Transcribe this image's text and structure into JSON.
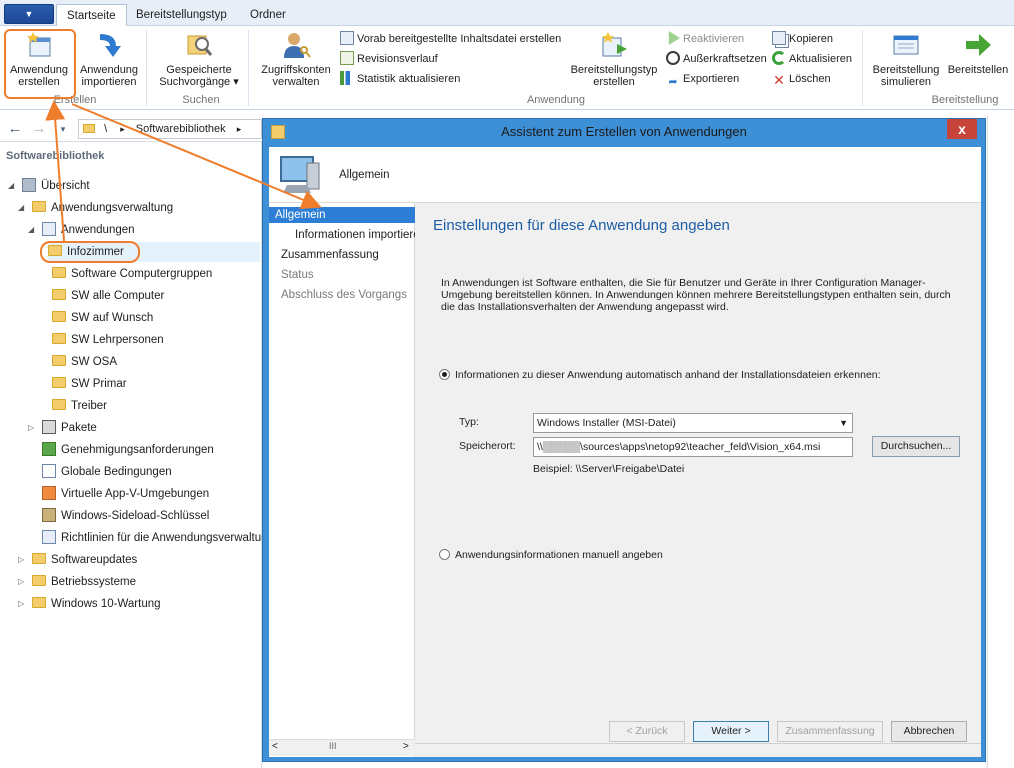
{
  "app_button": "▼",
  "tabs": [
    {
      "label": "Startseite",
      "active": true
    },
    {
      "label": "Bereitstellungstyp",
      "active": false
    },
    {
      "label": "Ordner",
      "active": false
    }
  ],
  "ribbon": {
    "groups": {
      "erstellen": "Erstellen",
      "suchen": "Suchen",
      "anwendung": "Anwendung",
      "bereitstellung": "Bereitstellung"
    },
    "anwendung_erstellen": "Anwendung\nerstellen",
    "anwendung_erstellen_l1": "Anwendung",
    "anwendung_erstellen_l2": "erstellen",
    "anwendung_importieren_l1": "Anwendung",
    "anwendung_importieren_l2": "importieren",
    "gespeicherte_l1": "Gespeicherte",
    "gespeicherte_l2": "Suchvorgänge ▾",
    "zugriffskonten_l1": "Zugriffskonten",
    "zugriffskonten_l2": "verwalten",
    "vorab": "Vorab bereitgestellte Inhaltsdatei erstellen",
    "revisionsverlauf": "Revisionsverlauf",
    "statistik": "Statistik aktualisieren",
    "bereitstellungstyp_l1": "Bereitstellungstyp",
    "bereitstellungstyp_l2": "erstellen",
    "reaktivieren": "Reaktivieren",
    "ausserkraft": "Außerkraftsetzen",
    "exportieren": "Exportieren",
    "kopieren": "Kopieren",
    "aktualisieren": "Aktualisieren",
    "loeschen": "Löschen",
    "bereitstellung_sim_l1": "Bereitstellung",
    "bereitstellung_sim_l2": "simulieren",
    "bereitstellen": "Bereitstellen"
  },
  "breadcrumb": {
    "root": "\\",
    "current": "Softwarebibliothek",
    "separator": "▸"
  },
  "sidebar": {
    "title": "Softwarebibliothek",
    "items": [
      {
        "label": "Übersicht"
      },
      {
        "label": "Anwendungsverwaltung"
      },
      {
        "label": "Anwendungen"
      },
      {
        "label": "Infozimmer"
      },
      {
        "label": "Software Computergruppen"
      },
      {
        "label": "SW alle Computer"
      },
      {
        "label": "SW auf Wunsch"
      },
      {
        "label": "SW Lehrpersonen"
      },
      {
        "label": "SW OSA"
      },
      {
        "label": "SW Primar"
      },
      {
        "label": "Treiber"
      },
      {
        "label": "Pakete"
      },
      {
        "label": "Genehmigungsanforderungen"
      },
      {
        "label": "Globale Bedingungen"
      },
      {
        "label": "Virtuelle App-V-Umgebungen"
      },
      {
        "label": "Windows-Sideload-Schlüssel"
      },
      {
        "label": "Richtlinien für die Anwendungsverwaltung"
      },
      {
        "label": "Softwareupdates"
      },
      {
        "label": "Betriebssysteme"
      },
      {
        "label": "Windows 10-Wartung"
      }
    ]
  },
  "wizard": {
    "title": "Assistent zum Erstellen von Anwendungen",
    "close": "x",
    "header_title": "Allgemein",
    "nav": [
      {
        "label": "Allgemein"
      },
      {
        "label": "Informationen importieren"
      },
      {
        "label": "Zusammenfassung"
      },
      {
        "label": "Status"
      },
      {
        "label": "Abschluss des Vorgangs"
      }
    ],
    "scroll_left": "<",
    "scroll_thumb": "III",
    "scroll_right": ">",
    "heading": "Einstellungen für diese Anwendung angeben",
    "description": "In Anwendungen ist Software enthalten, die Sie für Benutzer und Geräte in Ihrer Configuration Manager-Umgebung bereitstellen können. In Anwendungen können mehrere Bereitstellungstypen enthalten sein, durch die das Installationsverhalten der Anwendung angepasst wird.",
    "radio_auto": "Informationen zu dieser Anwendung automatisch anhand der Installationsdateien erkennen:",
    "type_label": "Typ:",
    "type_value": "Windows Installer (MSI-Datei)",
    "location_label": "Speicherort:",
    "location_value": "\\\\▒▒▒▒▒\\sources\\apps\\netop92\\teacher_feld\\Vision_x64.msi",
    "browse": "Durchsuchen...",
    "example": "Beispiel: \\\\Server\\Freigabe\\Datei",
    "radio_manual": "Anwendungsinformationen manuell angeben",
    "buttons": {
      "back": "< Zurück",
      "next": "Weiter >",
      "summary": "Zusammenfassung",
      "cancel": "Abbrechen"
    }
  },
  "colors": {
    "accent": "#2d7fd6",
    "callout": "#ee7d2c",
    "heading": "#1f5da6",
    "folder": "#f3cd6b"
  }
}
